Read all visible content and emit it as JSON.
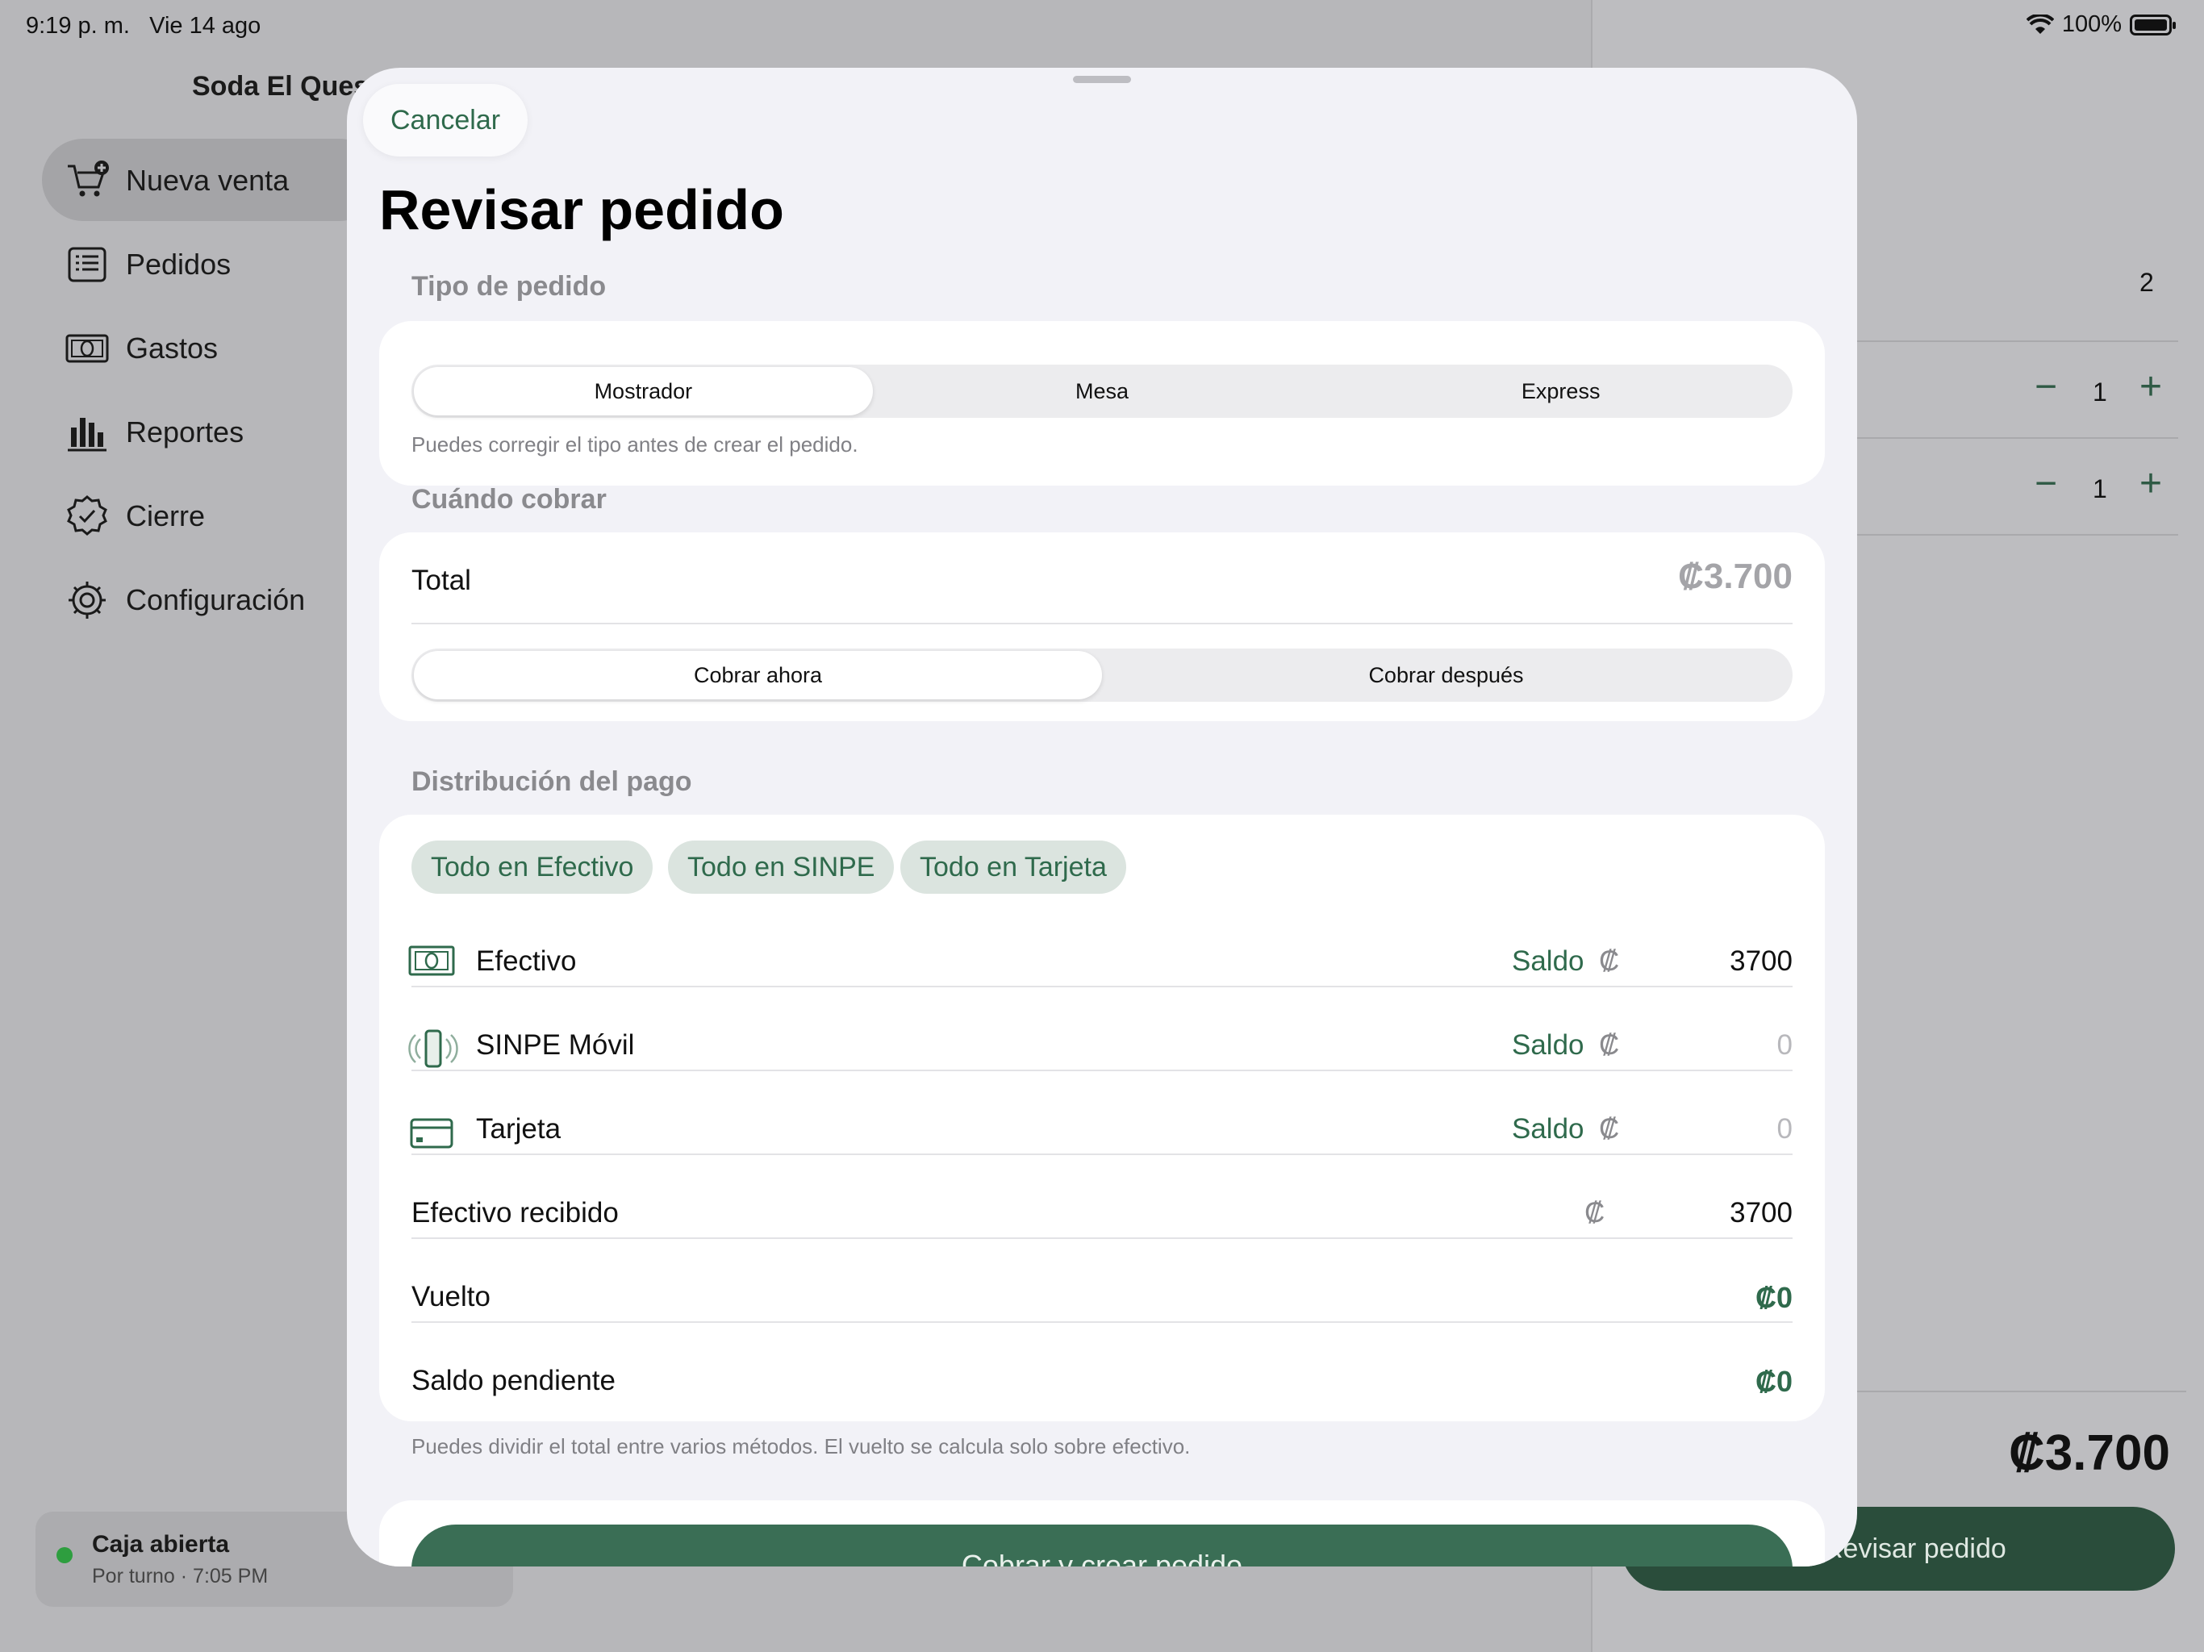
{
  "status_bar": {
    "time": "9:19 p. m.",
    "date": "Vie 14 ago",
    "battery": "100%"
  },
  "sidebar": {
    "shop_name": "Soda El Ques",
    "items": [
      {
        "label": "Nueva venta",
        "icon": "cart-plus-icon",
        "active": true
      },
      {
        "label": "Pedidos",
        "icon": "list-icon"
      },
      {
        "label": "Gastos",
        "icon": "banknote-icon"
      },
      {
        "label": "Reportes",
        "icon": "chart-bars-icon"
      },
      {
        "label": "Cierre",
        "icon": "checkmark-seal-icon"
      },
      {
        "label": "Configuración",
        "icon": "gear-icon"
      }
    ],
    "caja": {
      "title": "Caja abierta",
      "subtitle": "Por turno · 7:05 PM"
    }
  },
  "cart": {
    "count": "2",
    "items": [
      {
        "qty": "1"
      },
      {
        "qty": "1"
      }
    ],
    "total": "₡3.700",
    "review_button": "Revisar pedido"
  },
  "sheet": {
    "cancel": "Cancelar",
    "title": "Revisar pedido",
    "order_type": {
      "heading": "Tipo de pedido",
      "options": [
        "Mostrador",
        "Mesa",
        "Express"
      ],
      "selected": "Mostrador",
      "note": "Puedes corregir el tipo antes de crear el pedido."
    },
    "when": {
      "heading": "Cuándo cobrar",
      "total_label": "Total",
      "total_value": "₡3.700",
      "options": [
        "Cobrar ahora",
        "Cobrar después"
      ],
      "selected": "Cobrar ahora"
    },
    "payment": {
      "heading": "Distribución del pago",
      "quick": [
        "Todo en Efectivo",
        "Todo en SINPE",
        "Todo en Tarjeta"
      ],
      "methods": [
        {
          "name": "Efectivo",
          "icon": "cash-icon",
          "saldo": "Saldo",
          "currency": "₡",
          "amount": "3700"
        },
        {
          "name": "SINPE Móvil",
          "icon": "phone-waves-icon",
          "saldo": "Saldo",
          "currency": "₡",
          "amount": "0"
        },
        {
          "name": "Tarjeta",
          "icon": "credit-card-icon",
          "saldo": "Saldo",
          "currency": "₡",
          "amount": "0"
        }
      ],
      "cash_received": {
        "label": "Efectivo recibido",
        "currency": "₡",
        "amount": "3700"
      },
      "change": {
        "label": "Vuelto",
        "value": "₡0"
      },
      "pending": {
        "label": "Saldo pendiente",
        "value": "₡0"
      },
      "note": "Puedes dividir el total entre varios métodos. El vuelto se calcula solo sobre efectivo."
    },
    "cta": "Cobrar y crear pedido"
  }
}
